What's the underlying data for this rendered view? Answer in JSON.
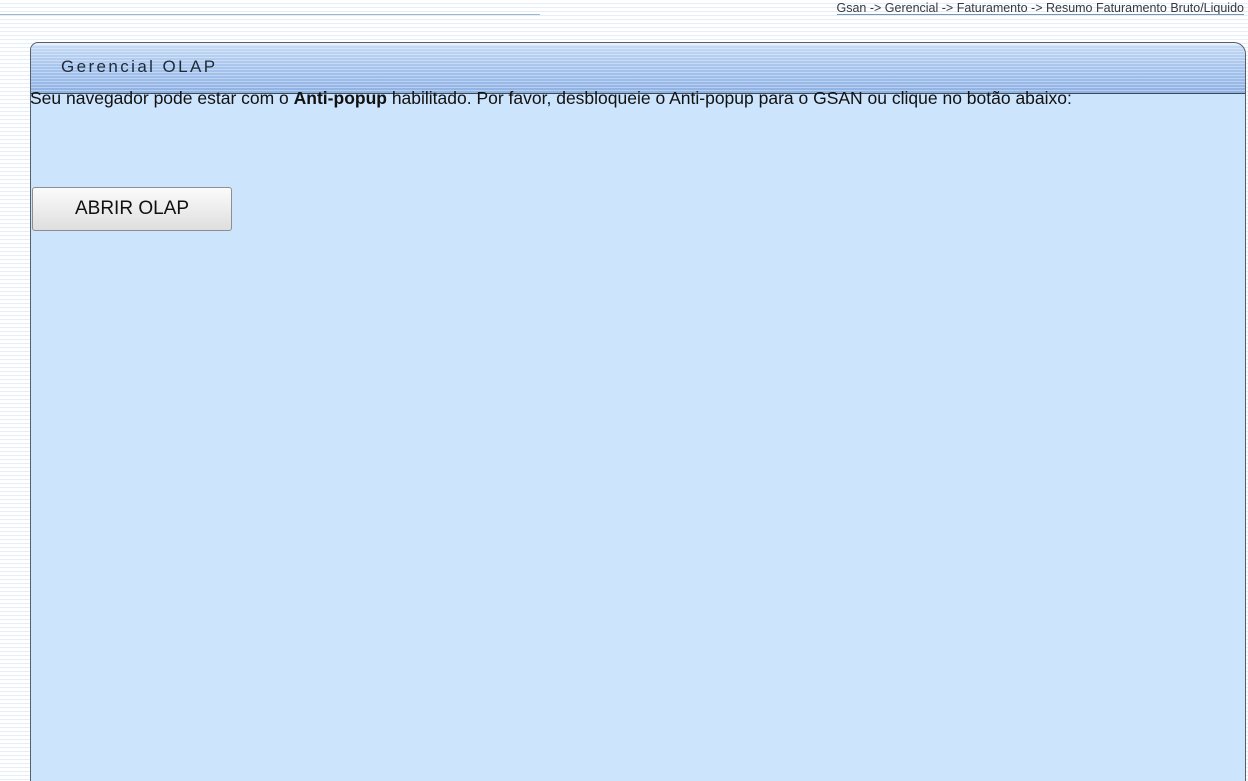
{
  "breadcrumb": {
    "path": "Gsan -> Gerencial -> Faturamento -> Resumo Faturamento Bruto/Liquido"
  },
  "panel": {
    "title": "Gerencial OLAP"
  },
  "message": {
    "part1": "Seu navegador pode estar com o ",
    "bold": "Anti-popup",
    "part2": " habilitado. Por favor, desbloqueie o Anti-popup para o GSAN ou clique no botão abaixo:"
  },
  "actions": {
    "open_olap_label": "ABRIR OLAP"
  },
  "colors": {
    "panel_background": "#cce4fc",
    "header_gradient_dark": "#8fb2e4",
    "page_stripe": "#e4eef8"
  }
}
